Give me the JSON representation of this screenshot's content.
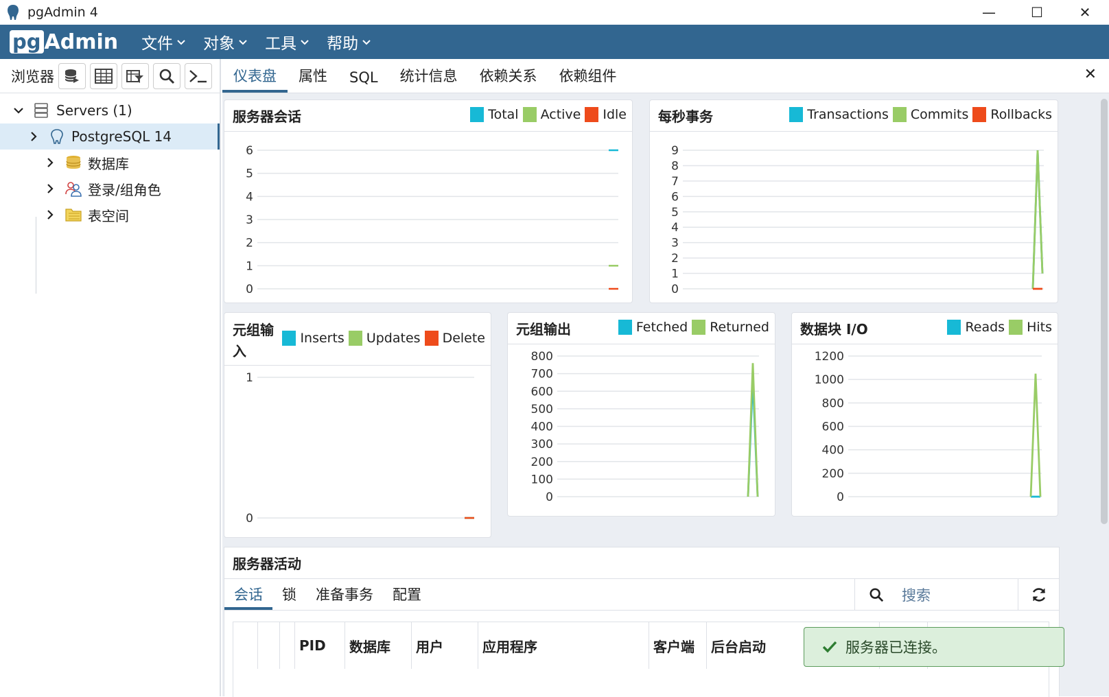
{
  "window": {
    "title": "pgAdmin 4",
    "minimize": "—",
    "maximize": "☐",
    "close": "✕"
  },
  "brand": {
    "pg": "pg",
    "admin": "Admin"
  },
  "menu": [
    "文件",
    "对象",
    "工具",
    "帮助"
  ],
  "browser": {
    "label": "浏览器",
    "tree": [
      {
        "label": "Servers (1)",
        "level": 0,
        "expanded": true
      },
      {
        "label": "PostgreSQL 14",
        "level": 1,
        "expanded": false,
        "selected": true
      },
      {
        "label": "数据库",
        "level": 2
      },
      {
        "label": "登录/组角色",
        "level": 2
      },
      {
        "label": "表空间",
        "level": 2
      }
    ]
  },
  "tabs": [
    "仪表盘",
    "属性",
    "SQL",
    "统计信息",
    "依赖关系",
    "依赖组件"
  ],
  "tab_close": "✕",
  "colors": {
    "teal": "#17b9d6",
    "green": "#99cc66",
    "orange": "#ee4b1b",
    "brand": "#326690"
  },
  "cards": {
    "sessions": {
      "title": "服务器会话",
      "legend": [
        "Total",
        "Active",
        "Idle"
      ]
    },
    "tps": {
      "title": "每秒事务",
      "legend": [
        "Transactions",
        "Commits",
        "Rollbacks"
      ]
    },
    "tuples_in": {
      "title": "元组输入",
      "legend": [
        "Inserts",
        "Updates",
        "Delete"
      ]
    },
    "tuples_out": {
      "title": "元组输出",
      "legend": [
        "Fetched",
        "Returned"
      ]
    },
    "block_io": {
      "title": "数据块 I/O",
      "legend": [
        "Reads",
        "Hits"
      ]
    }
  },
  "chart_data": [
    {
      "type": "line",
      "title": "服务器会话",
      "ylim": [
        0,
        6
      ],
      "yticks": [
        0,
        1,
        2,
        3,
        4,
        5,
        6
      ],
      "series": [
        {
          "name": "Total",
          "values": [
            6
          ]
        },
        {
          "name": "Active",
          "values": [
            1
          ]
        },
        {
          "name": "Idle",
          "values": [
            0
          ]
        }
      ]
    },
    {
      "type": "line",
      "title": "每秒事务",
      "ylim": [
        0,
        9
      ],
      "yticks": [
        0,
        1,
        2,
        3,
        4,
        5,
        6,
        7,
        8,
        9
      ],
      "series": [
        {
          "name": "Transactions",
          "values": [
            0,
            9,
            1
          ]
        },
        {
          "name": "Commits",
          "values": [
            0,
            9,
            1
          ]
        },
        {
          "name": "Rollbacks",
          "values": [
            0,
            0,
            0
          ]
        }
      ]
    },
    {
      "type": "line",
      "title": "元组输入",
      "ylim": [
        0,
        1
      ],
      "yticks": [
        0,
        1
      ],
      "series": [
        {
          "name": "Inserts",
          "values": [
            0
          ]
        },
        {
          "name": "Updates",
          "values": [
            0
          ]
        },
        {
          "name": "Delete",
          "values": [
            0
          ]
        }
      ]
    },
    {
      "type": "line",
      "title": "元组输出",
      "ylim": [
        0,
        800
      ],
      "yticks": [
        0,
        100,
        200,
        300,
        400,
        500,
        600,
        700,
        800
      ],
      "series": [
        {
          "name": "Fetched",
          "values": [
            0,
            670,
            0
          ]
        },
        {
          "name": "Returned",
          "values": [
            0,
            760,
            0
          ]
        }
      ]
    },
    {
      "type": "line",
      "title": "数据块 I/O",
      "ylim": [
        0,
        1200
      ],
      "yticks": [
        0,
        200,
        400,
        600,
        800,
        1000,
        1200
      ],
      "series": [
        {
          "name": "Reads",
          "values": [
            0,
            0,
            0
          ]
        },
        {
          "name": "Hits",
          "values": [
            0,
            1050,
            0
          ]
        }
      ]
    }
  ],
  "activity": {
    "title": "服务器活动",
    "tabs": [
      "会话",
      "锁",
      "准备事务",
      "配置"
    ],
    "search_placeholder": "搜索",
    "columns": [
      "PID",
      "数据库",
      "用户",
      "应用程序",
      "客户端",
      "后台启动"
    ]
  },
  "toast": {
    "message": "服务器已连接。"
  }
}
